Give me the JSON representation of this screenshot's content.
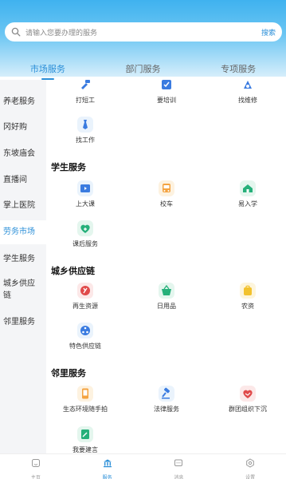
{
  "search": {
    "placeholder": "请输入您要办理的服务",
    "button": "搜索"
  },
  "tabs": [
    {
      "label": "市场服务",
      "active": true
    },
    {
      "label": "部门服务"
    },
    {
      "label": "专项服务"
    }
  ],
  "sidebar": {
    "items": [
      {
        "label": "养老服务"
      },
      {
        "label": "冈好购"
      },
      {
        "label": "东坡庙会"
      },
      {
        "label": "直播间"
      },
      {
        "label": "掌上医院"
      },
      {
        "label": "劳务市场",
        "active": true
      },
      {
        "label": "学生服务"
      },
      {
        "label": "城乡供应链"
      },
      {
        "label": "邻里服务"
      }
    ]
  },
  "sections": {
    "labor": {
      "items": [
        {
          "label": "打短工",
          "icon": "hammer-icon"
        },
        {
          "label": "要培训",
          "icon": "training-icon"
        },
        {
          "label": "找维修",
          "icon": "repair-icon"
        },
        {
          "label": "找工作",
          "icon": "tie-icon"
        }
      ]
    },
    "student": {
      "title": "学生服务",
      "items": [
        {
          "label": "上大课",
          "icon": "class-icon"
        },
        {
          "label": "校车",
          "icon": "bus-icon"
        },
        {
          "label": "易入学",
          "icon": "enroll-icon"
        },
        {
          "label": "课后服务",
          "icon": "after-school-icon"
        }
      ]
    },
    "supply": {
      "title": "城乡供应链",
      "items": [
        {
          "label": "再生资源",
          "icon": "recycle-icon"
        },
        {
          "label": "日用品",
          "icon": "basket-icon"
        },
        {
          "label": "农资",
          "icon": "bag-icon"
        },
        {
          "label": "特色供应链",
          "icon": "network-icon"
        }
      ]
    },
    "neighbor": {
      "title": "邻里服务",
      "items": [
        {
          "label": "生态环境随手拍",
          "icon": "phone-icon"
        },
        {
          "label": "法律服务",
          "icon": "gavel-icon"
        },
        {
          "label": "群团组织下沉",
          "icon": "handshake-icon"
        },
        {
          "label": "我要建言",
          "icon": "suggest-icon"
        }
      ]
    }
  },
  "bottom_nav": [
    {
      "label": "主页",
      "icon": "home-icon"
    },
    {
      "label": "服务",
      "icon": "bank-icon",
      "active": true
    },
    {
      "label": "消息",
      "icon": "message-icon"
    },
    {
      "label": "设置",
      "icon": "settings-icon"
    }
  ],
  "colors": {
    "accent": "#2b8fd8",
    "header_top": "#3fb2ef",
    "sidebar_bg": "#f4f5f7",
    "orange": "#f4a340",
    "blue": "#3a7be0",
    "green": "#26b07a",
    "red": "#e04a4a",
    "yellow": "#f2c22e"
  }
}
